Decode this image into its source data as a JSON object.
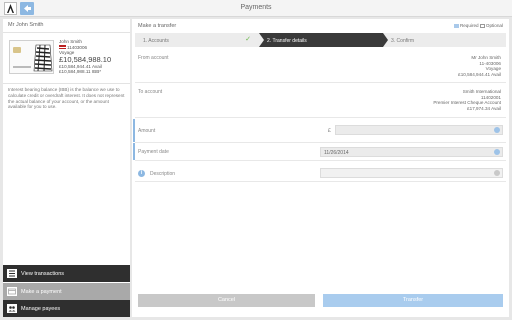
{
  "app": {
    "title": "Payments"
  },
  "account": {
    "holder": "Mr John Smith",
    "name": "John Smith",
    "number": "11403006",
    "product": "Voyage",
    "balance": "£10,584,988.10",
    "avail": "£10,584,944.41 Avail",
    "ibb": "£10,584,988.11 IBB*"
  },
  "note": "Interest bearing balance (IBB) is the balance we use to calculate credit or overdraft interest. It does not represent the actual balance of your account, or the amount available for you to use.",
  "menu": [
    {
      "label": "View transactions",
      "icon": "list-icon"
    },
    {
      "label": "Make a payment",
      "icon": "card-icon"
    },
    {
      "label": "Manage payees",
      "icon": "contacts-icon"
    }
  ],
  "transfer": {
    "heading": "Make a transfer",
    "legend": {
      "required": "Required",
      "optional": "Optional"
    },
    "steps": [
      "1. Accounts",
      "2. Transfer details",
      "3. Confirm"
    ],
    "from": {
      "label": "From account",
      "lines": [
        "Mr John Smith",
        "11-403006",
        "Voyage",
        "£10,584,944.41 Avail"
      ]
    },
    "to": {
      "label": "To account",
      "lines": [
        "Smith International",
        "11402001",
        "Premier Interest Cheque Account",
        "£17,974.34 Avail"
      ]
    },
    "amount": {
      "label": "Amount",
      "currency": "£",
      "value": ""
    },
    "payment_date": {
      "label": "Payment date",
      "value": "11/26/2014"
    },
    "description": {
      "label": "Description",
      "value": ""
    },
    "buttons": {
      "cancel": "Cancel",
      "transfer": "Transfer"
    }
  },
  "colors": {
    "accent": "#8db8e2",
    "dark": "#2f2f2f",
    "success": "#6bb84a"
  }
}
